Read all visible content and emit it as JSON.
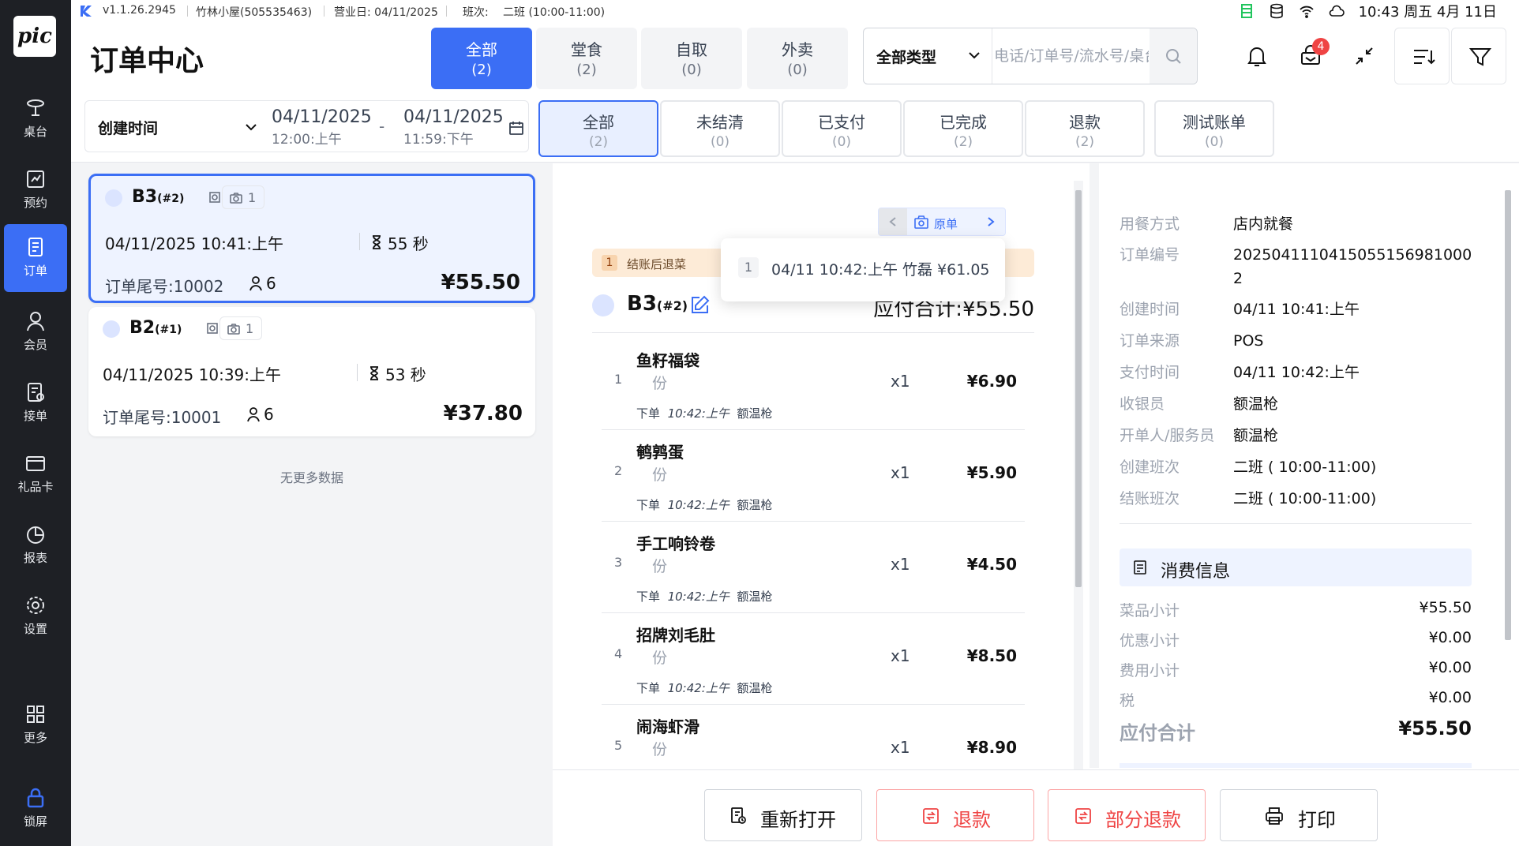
{
  "app": {
    "logo_text": "pic"
  },
  "sidebar": {
    "items": [
      {
        "label": "桌台",
        "icon": "dining-table-icon"
      },
      {
        "label": "预约",
        "icon": "reservation-icon"
      },
      {
        "label": "订单",
        "icon": "order-icon",
        "active": true
      },
      {
        "label": "会员",
        "icon": "member-icon"
      },
      {
        "label": "接单",
        "icon": "accept-order-icon"
      },
      {
        "label": "礼品卡",
        "icon": "gift-card-icon"
      },
      {
        "label": "报表",
        "icon": "report-icon"
      },
      {
        "label": "设置",
        "icon": "settings-icon"
      },
      {
        "label": "更多",
        "icon": "more-grid-icon"
      },
      {
        "label": "锁屏",
        "icon": "lock-icon"
      }
    ]
  },
  "topbar": {
    "version": "v1.1.26.2945",
    "store": "竹林小屋(505535463)",
    "business_day": "营业日: 04/11/2025",
    "shift_label": "班次:",
    "shift_value": "二班 (10:00-11:00)",
    "clock": "10:43 周五 4月 11日"
  },
  "header": {
    "title": "订单中心",
    "type_tabs": [
      {
        "label": "全部",
        "count": "(2)",
        "active": true
      },
      {
        "label": "堂食",
        "count": "(2)"
      },
      {
        "label": "自取",
        "count": "(0)"
      },
      {
        "label": "外卖",
        "count": "(0)"
      }
    ],
    "search": {
      "type_label": "全部类型",
      "placeholder": "电话/订单号/流水号/桌台"
    },
    "notification_badge": "4",
    "date_filter": {
      "label": "创建时间",
      "start_date": "04/11/2025",
      "start_time": "12:00:上午",
      "end_date": "04/11/2025",
      "end_time": "11:59:下午",
      "dash": "-"
    },
    "status_tabs": [
      {
        "label": "全部",
        "count": "(2)",
        "active": true
      },
      {
        "label": "未结清",
        "count": "(0)"
      },
      {
        "label": "已支付",
        "count": "(0)"
      },
      {
        "label": "已完成",
        "count": "(2)"
      },
      {
        "label": "退款",
        "count": "(2)"
      },
      {
        "label": "测试账单",
        "count": "(0)"
      }
    ]
  },
  "orders": [
    {
      "table": "B3",
      "seq": "(#2)",
      "photo_count": "1",
      "time": "04/11/2025 10:41:上午",
      "duration": "55 秒",
      "tail": "订单尾号:10002",
      "guests": "6",
      "total": "¥55.50",
      "active": true
    },
    {
      "table": "B2",
      "seq": "(#1)",
      "photo_count": "1",
      "time": "04/11/2025 10:39:上午",
      "duration": "53 秒",
      "tail": "订单尾号:10001",
      "guests": "6",
      "total": "¥37.80"
    }
  ],
  "no_more": "无更多数据",
  "detail": {
    "pager_label": "原单",
    "refund_banner": {
      "num": "1",
      "text": "结账后退菜"
    },
    "tooltip": {
      "num": "1",
      "text": "04/11 10:42:上午 竹磊 ¥61.05"
    },
    "table": "B3",
    "seq": "(#2)",
    "total_text": "应付合计:¥55.50",
    "items": [
      {
        "no": "1",
        "name": "鱼籽福袋",
        "unit": "份",
        "meta_prefix": "下单",
        "meta_time": "10:42:上午",
        "meta_staff": "额温枪",
        "qty": "x1",
        "price": "¥6.90"
      },
      {
        "no": "2",
        "name": "鹌鹑蛋",
        "unit": "份",
        "meta_prefix": "下单",
        "meta_time": "10:42:上午",
        "meta_staff": "额温枪",
        "qty": "x1",
        "price": "¥5.90"
      },
      {
        "no": "3",
        "name": "手工响铃卷",
        "unit": "份",
        "meta_prefix": "下单",
        "meta_time": "10:42:上午",
        "meta_staff": "额温枪",
        "qty": "x1",
        "price": "¥4.50"
      },
      {
        "no": "4",
        "name": "招牌刘毛肚",
        "unit": "份",
        "meta_prefix": "下单",
        "meta_time": "10:42:上午",
        "meta_staff": "额温枪",
        "qty": "x1",
        "price": "¥8.50"
      },
      {
        "no": "5",
        "name": "闹海虾滑",
        "unit": "份",
        "meta_prefix": "",
        "meta_time": "",
        "meta_staff": "",
        "qty": "x1",
        "price": "¥8.90"
      }
    ],
    "info": [
      {
        "label": "用餐方式",
        "value": "店内就餐"
      },
      {
        "label": "订单编号",
        "value": "2025041110415055156981000 2"
      },
      {
        "label": "创建时间",
        "value": "04/11 10:41:上午"
      },
      {
        "label": "订单来源",
        "value": "POS"
      },
      {
        "label": "支付时间",
        "value": "04/11 10:42:上午"
      },
      {
        "label": "收银员",
        "value": "额温枪"
      },
      {
        "label": "开单人/服务员",
        "value": "额温枪"
      },
      {
        "label": "创建班次",
        "value": "二班 ( 10:00-11:00)"
      },
      {
        "label": "结账班次",
        "value": "二班 ( 10:00-11:00)"
      }
    ],
    "consumption": {
      "title": "消费信息",
      "rows": [
        {
          "label": "菜品小计",
          "value": "¥55.50"
        },
        {
          "label": "优惠小计",
          "value": "¥0.00"
        },
        {
          "label": "费用小计",
          "value": "¥0.00"
        },
        {
          "label": "税",
          "value": "¥0.00"
        }
      ],
      "total_label": "应付合计",
      "total_value": "¥55.50"
    },
    "actions": [
      {
        "label": "重新打开"
      },
      {
        "label": "退款"
      },
      {
        "label": "部分退款"
      },
      {
        "label": "打印"
      }
    ]
  }
}
